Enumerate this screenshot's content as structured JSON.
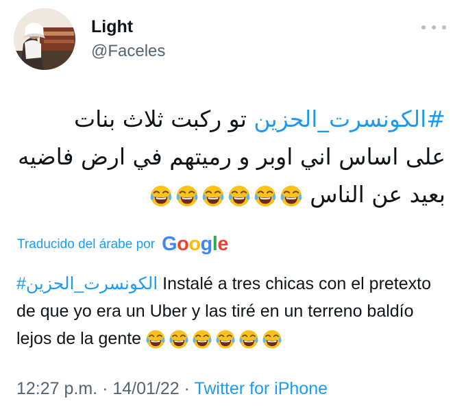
{
  "user": {
    "display_name": "Light",
    "handle": "@Faceles",
    "avatar_icon": "profile-photo"
  },
  "more_icon": "ellipsis-icon",
  "tweet": {
    "hashtag": "#الكونسرت_الحزين",
    "line1_rest": " تو ركبت ثلاث بنات",
    "line2": "على اساس اني اوبر و رميتهم في ارض فاضيه",
    "line3": "بعيد عن الناس",
    "emoji_count": 6,
    "emoji_icon": "face-with-tears-of-joy"
  },
  "translation": {
    "label": "Traducido del árabe por",
    "provider": "Google",
    "hashtag": "#الكونسرت_الحزين",
    "text": "Instalé a tres chicas con el pretexto de que yo era un Uber y las tiré en un terreno baldío lejos de la gente",
    "emoji_count": 6
  },
  "meta": {
    "time": "12:27 p.m.",
    "separator": "·",
    "date": "14/01/22",
    "source": "Twitter for iPhone"
  },
  "colors": {
    "link": "#1d9bf0",
    "secondary": "#536471",
    "text": "#0f1419"
  }
}
